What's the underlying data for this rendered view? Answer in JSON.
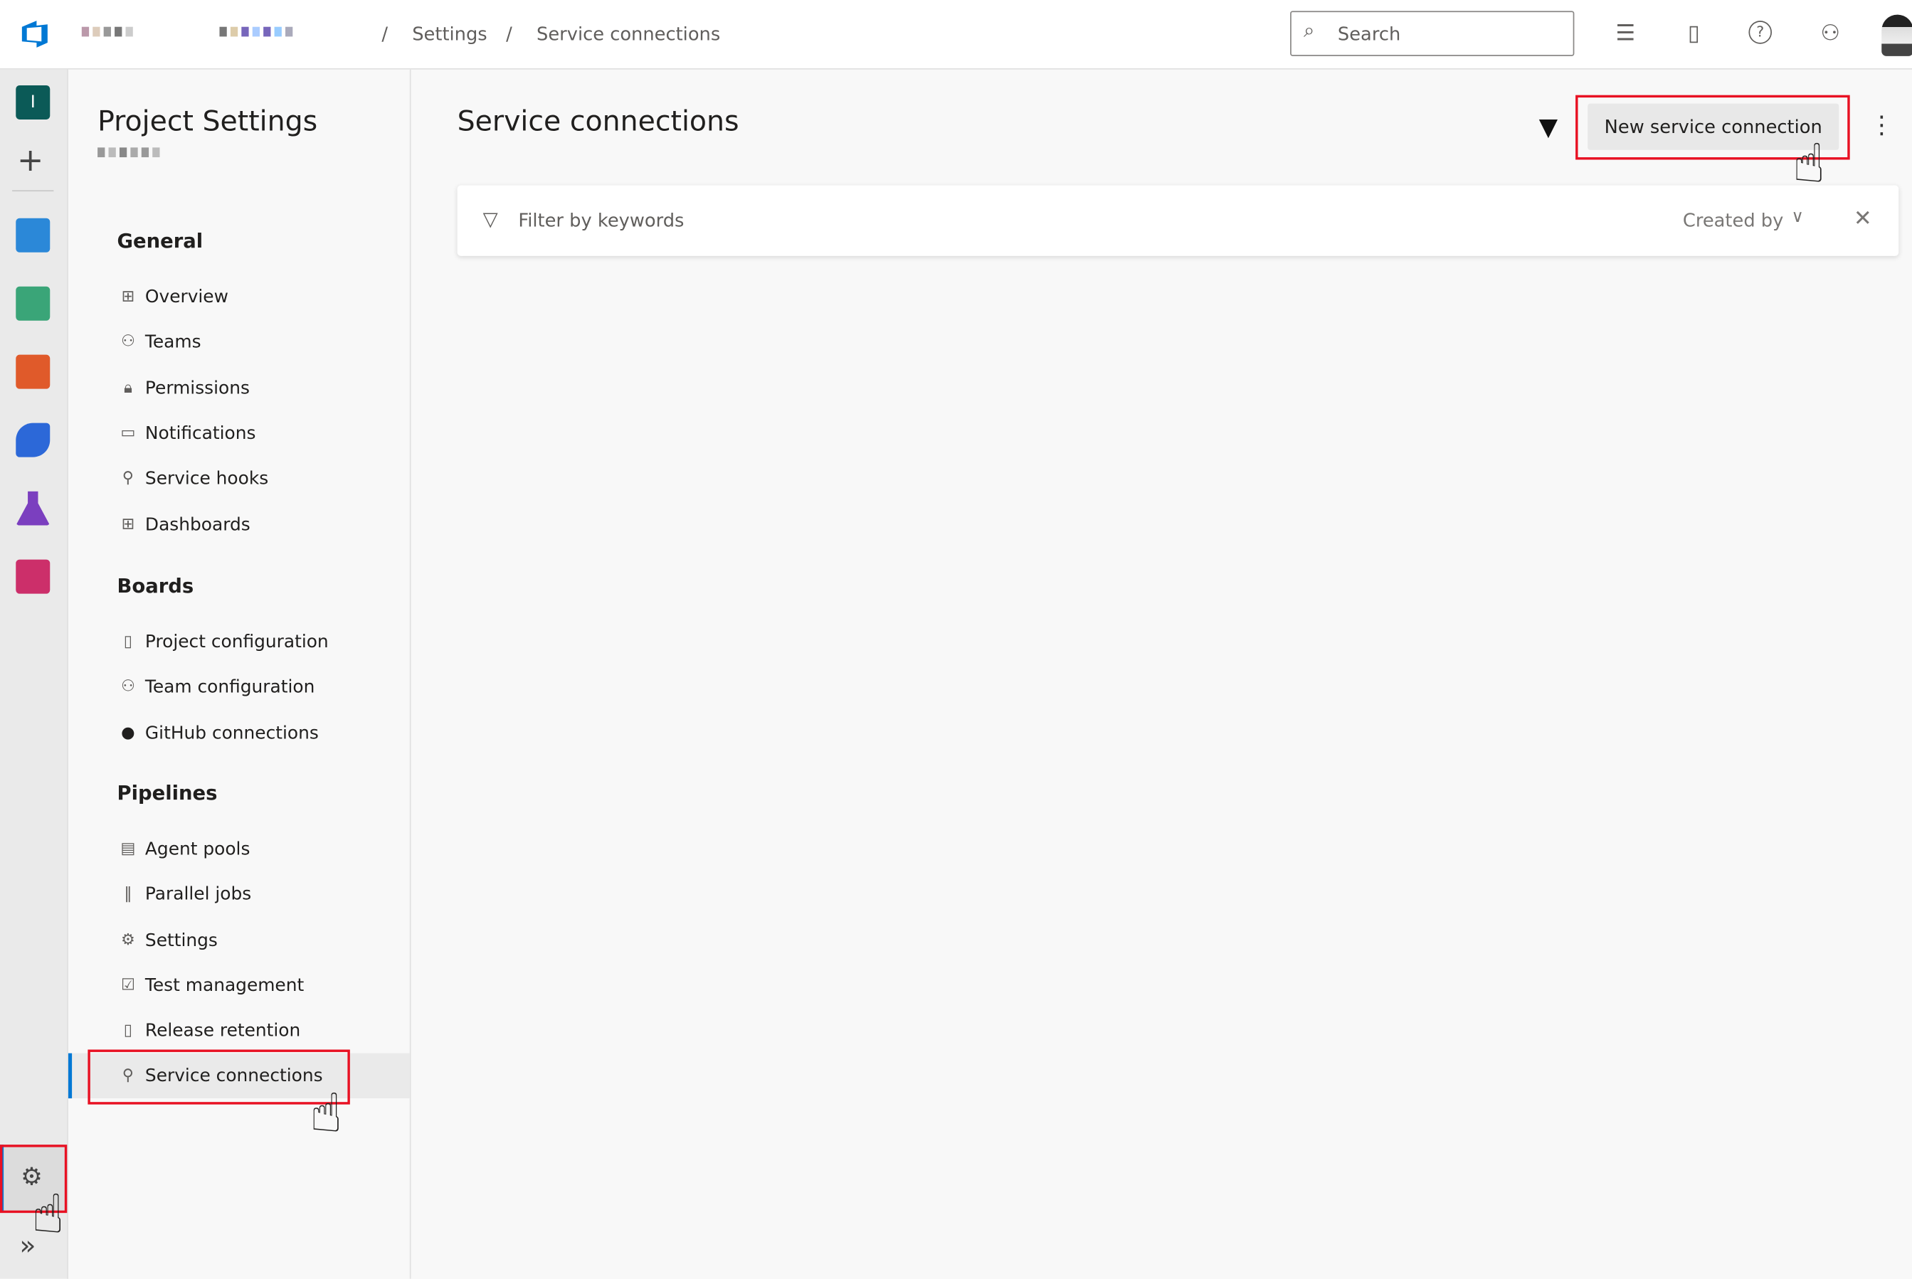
{
  "header": {
    "breadcrumb": [
      "Settings",
      "Service connections"
    ],
    "search_placeholder": "Search",
    "icons": [
      "azure-devops-logo",
      "task-list-icon",
      "marketplace-bag-icon",
      "help-icon",
      "user-settings-icon",
      "avatar"
    ]
  },
  "rail": {
    "org_initial": "I",
    "items": [
      "add-icon",
      "overview-icon",
      "boards-icon",
      "repos-icon",
      "pipelines-icon",
      "test-plans-icon",
      "artifacts-icon"
    ],
    "settings": "project-settings-gear-icon",
    "expand": "expand-icon"
  },
  "nav": {
    "title": "Project Settings",
    "sections": [
      {
        "heading": "General",
        "items": [
          {
            "label": "Overview",
            "icon": "overview-icon"
          },
          {
            "label": "Teams",
            "icon": "teams-icon"
          },
          {
            "label": "Permissions",
            "icon": "lock-icon"
          },
          {
            "label": "Notifications",
            "icon": "chat-icon"
          },
          {
            "label": "Service hooks",
            "icon": "plug-icon"
          },
          {
            "label": "Dashboards",
            "icon": "dashboard-icon"
          }
        ]
      },
      {
        "heading": "Boards",
        "items": [
          {
            "label": "Project configuration",
            "icon": "document-settings-icon"
          },
          {
            "label": "Team configuration",
            "icon": "team-config-icon"
          },
          {
            "label": "GitHub connections",
            "icon": "github-icon"
          }
        ]
      },
      {
        "heading": "Pipelines",
        "items": [
          {
            "label": "Agent pools",
            "icon": "agent-pool-icon"
          },
          {
            "label": "Parallel jobs",
            "icon": "parallel-icon"
          },
          {
            "label": "Settings",
            "icon": "gear-icon"
          },
          {
            "label": "Test management",
            "icon": "test-icon"
          },
          {
            "label": "Release retention",
            "icon": "phone-icon"
          },
          {
            "label": "Service connections",
            "icon": "plug-icon",
            "selected": true
          }
        ]
      }
    ]
  },
  "main": {
    "title": "Service connections",
    "new_button": "New service connection",
    "filter_placeholder": "Filter by keywords",
    "created_by": "Created by"
  },
  "colors": {
    "accent": "#0078d4",
    "highlight": "#e81123"
  }
}
